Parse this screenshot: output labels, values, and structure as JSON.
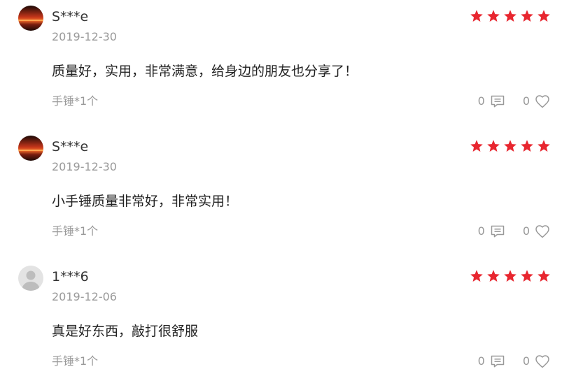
{
  "colors": {
    "star": "#e8262f",
    "muted": "#999999",
    "text": "#222222"
  },
  "reviews": [
    {
      "avatar": "sunset-avatar",
      "username": "S***e",
      "date": "2019-12-30",
      "rating": 5,
      "content": "质量好，实用，非常满意，给身边的朋友也分享了！",
      "spec": "手锤*1个",
      "comment_count": "0",
      "like_count": "0"
    },
    {
      "avatar": "sunset-avatar",
      "username": "S***e",
      "date": "2019-12-30",
      "rating": 5,
      "content": "小手锤质量非常好，非常实用！",
      "spec": "手锤*1个",
      "comment_count": "0",
      "like_count": "0"
    },
    {
      "avatar": "default-user-avatar",
      "username": "1***6",
      "date": "2019-12-06",
      "rating": 5,
      "content": "真是好东西，敲打很舒服",
      "spec": "手锤*1个",
      "comment_count": "0",
      "like_count": "0"
    }
  ]
}
